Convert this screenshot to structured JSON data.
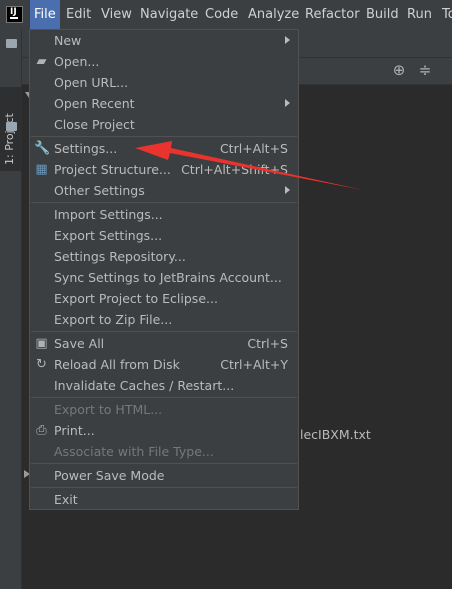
{
  "menubar": {
    "items": [
      "File",
      "Edit",
      "View",
      "Navigate",
      "Code",
      "Analyze",
      "Refactor",
      "Build",
      "Run",
      "To"
    ]
  },
  "toolwindow": {
    "project_tab": "1: Project"
  },
  "background": {
    "filename_fragment": "lecIBXM.txt"
  },
  "file_menu": {
    "new": "New",
    "open": "Open...",
    "open_url": "Open URL...",
    "open_recent": "Open Recent",
    "close_project": "Close Project",
    "settings": "Settings...",
    "settings_shortcut": "Ctrl+Alt+S",
    "project_structure": "Project Structure...",
    "project_structure_shortcut": "Ctrl+Alt+Shift+S",
    "other_settings": "Other Settings",
    "import_settings": "Import Settings...",
    "export_settings": "Export Settings...",
    "settings_repository": "Settings Repository...",
    "sync_settings": "Sync Settings to JetBrains Account...",
    "export_eclipse": "Export Project to Eclipse...",
    "export_zip": "Export to Zip File...",
    "save_all": "Save All",
    "save_all_shortcut": "Ctrl+S",
    "reload": "Reload All from Disk",
    "reload_shortcut": "Ctrl+Alt+Y",
    "invalidate": "Invalidate Caches / Restart...",
    "export_html": "Export to HTML...",
    "print": "Print...",
    "associate": "Associate with File Type...",
    "power_save": "Power Save Mode",
    "exit": "Exit"
  },
  "colors": {
    "menu_active": "#4b6eaf",
    "menu_bg": "#3c3f41",
    "annotation_arrow": "#e8332e"
  }
}
